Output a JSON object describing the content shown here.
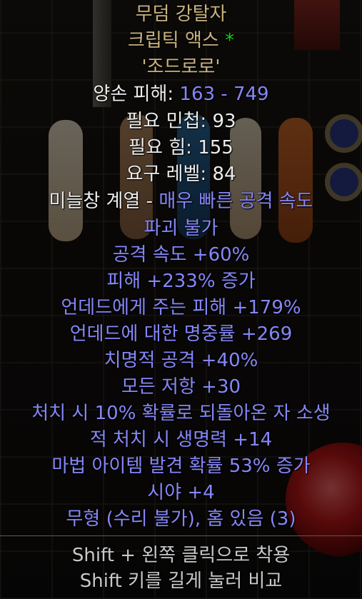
{
  "item": {
    "name": "무덤 강탈자",
    "base_type": "크립틱 액스",
    "socket_marker": "*",
    "personalized": "'조드로로'",
    "damage_label": "양손 피해: ",
    "damage_value": "163 - 749",
    "req_dex": "필요 민첩: 93",
    "req_str": "필요 힘: 155",
    "req_level": "요구 레벨: 84",
    "weapon_class_label": "미늘창 계열 - ",
    "attack_speed_class": "매우 빠른 공격 속도",
    "properties": [
      "파괴 불가",
      "공격 속도 +60%",
      "피해 +233% 증가",
      "언데드에게 주는 피해 +179%",
      "언데드에 대한 명중률 +269",
      "치명적 공격 +40%",
      "모든 저항 +30",
      "처치 시 10% 확률로 되돌아온 자 소생",
      "적 처치 시 생명력 +14",
      "마법 아이템 발견 확률 53% 증가",
      "시야 +4",
      "무형 (수리 불가), 홈 있음 (3)"
    ],
    "hints": [
      "Shift + 왼쪽 클릭으로 착용",
      "Shift 키를 길게 눌러 비교"
    ]
  },
  "colors": {
    "unique_name": "#c9b37e",
    "magic_property": "#8687f7",
    "default_text": "#ececec",
    "hint_text": "#c8c8c8",
    "socket_marker": "#19d019"
  }
}
